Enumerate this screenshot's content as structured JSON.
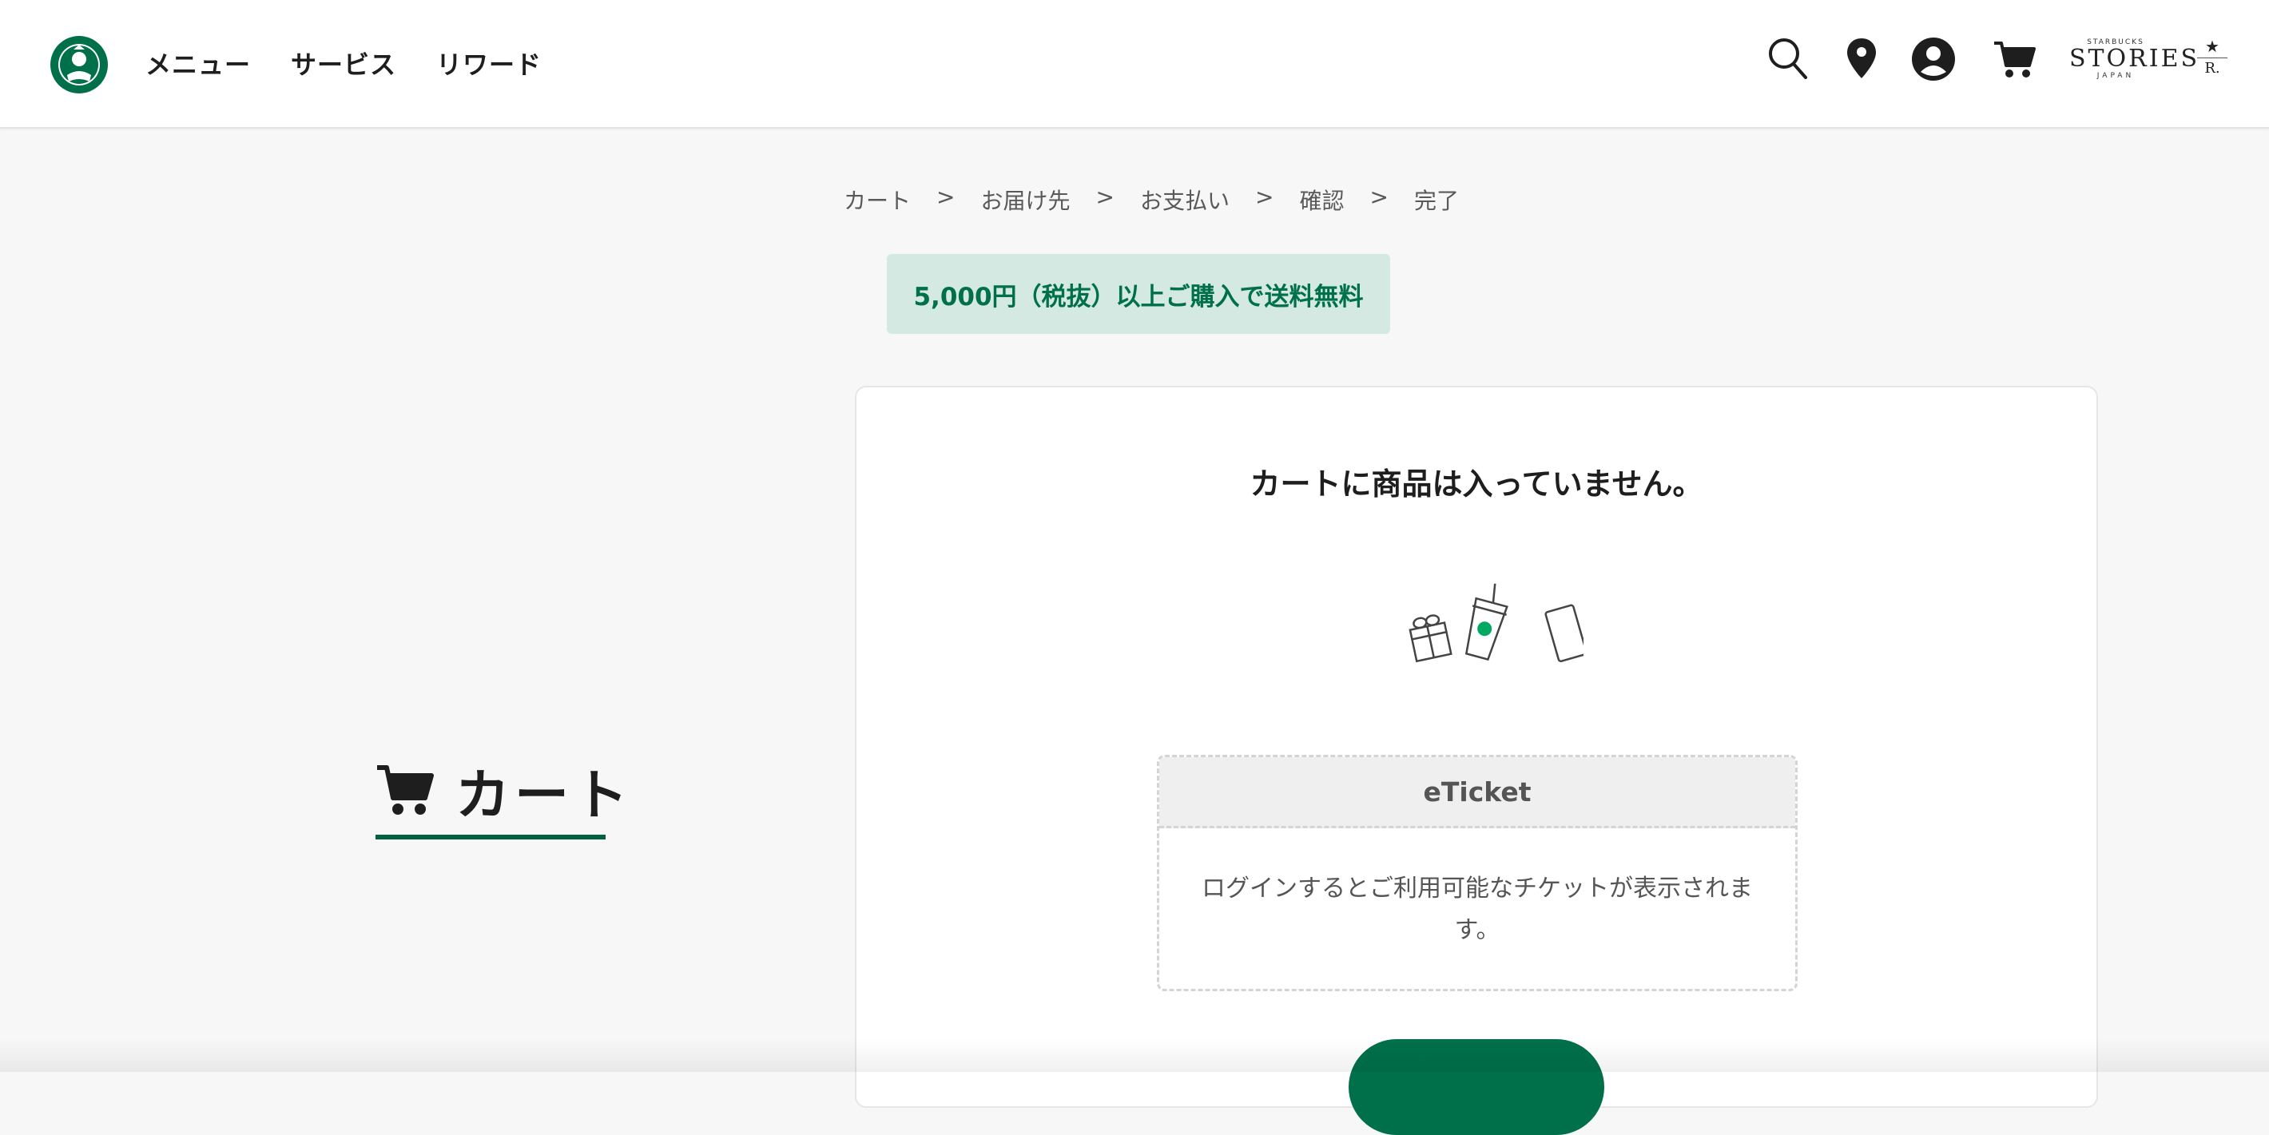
{
  "header": {
    "nav": [
      "メニュー",
      "サービス",
      "リワード"
    ],
    "icons": [
      "search-icon",
      "location-pin-icon",
      "account-icon",
      "cart-icon"
    ],
    "stories_logo": {
      "top": "STARBUCKS",
      "main": "STORIES",
      "bottom": "JAPAN"
    },
    "reserve_logo": {
      "star": "★",
      "letter": "R."
    }
  },
  "breadcrumb": [
    "カート",
    "お届け先",
    "お支払い",
    "確認",
    "完了"
  ],
  "breadcrumb_separator": ">",
  "banner": {
    "text": "5,000円（税抜）以上ご購入で送料無料"
  },
  "page_title": "カート",
  "card": {
    "empty_message": "カートに商品は入っていません。",
    "eticket": {
      "title": "eTicket",
      "message": "ログインするとご利用可能なチケットが表示されます。"
    }
  },
  "colors": {
    "brand_green": "#00704a",
    "banner_bg": "#d4e9e2",
    "underline": "#006241"
  }
}
